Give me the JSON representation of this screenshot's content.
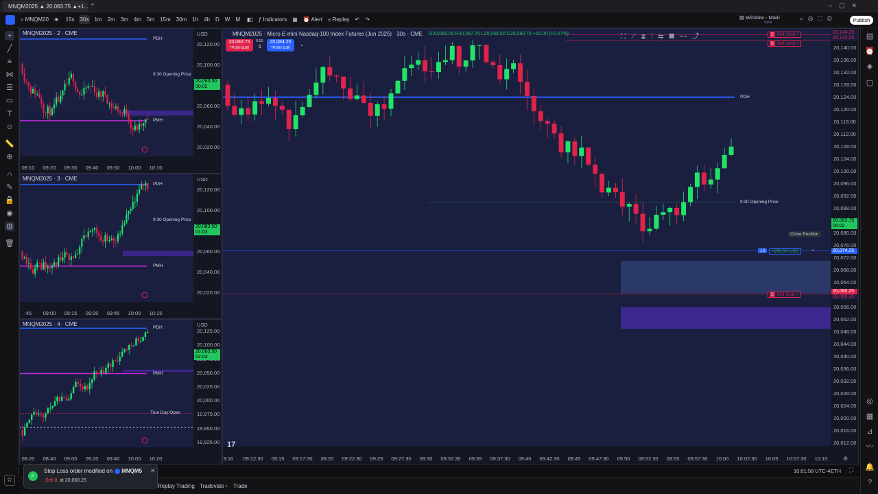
{
  "tab": {
    "title": "MNQM2025 ▲ 20,083.75 ▲+1..."
  },
  "toolbar": {
    "symbol": "MNQM20",
    "timeframes": [
      "15s",
      "30s",
      "1m",
      "2m",
      "3m",
      "4m",
      "5m",
      "15m",
      "30m",
      "1h",
      "4h",
      "D",
      "W",
      "M"
    ],
    "active_tf": "30s",
    "indicators": "Indicators",
    "alert": "Alert",
    "replay": "Replay",
    "layout": "Window - Main",
    "layout_sub": "Save",
    "publish": "Publish"
  },
  "main": {
    "title": "MNQM2025 · Micro E-mini Nasdaq-100 Index Futures (Jun 2025) · 30s · CME",
    "ohlc": "O20,069.00 H20,087.75 L20,068.50 C20,083.75 +15.00 (+0.07%)",
    "sell_price": "20,083.75",
    "sell_sub": "TP160·SL80",
    "spread": "0.50",
    "qty": "5",
    "buy_price": "20,084.25",
    "buy_sub": "TP160·SL80",
    "currency": "USD",
    "pdh": "PDH",
    "opening": "9:30 Opening Price",
    "close_position": "Close Position",
    "pos_qty": "13",
    "pos_pnl": "+250.50 USD",
    "sell_limit_1_qty": "5",
    "sell_limit_1": "Sell Limit",
    "sell_limit_2_qty": "8",
    "sell_limit_2": "Sell Limit",
    "sell_stop_qty": "5",
    "sell_stop": "Sell Stop",
    "last_price": "20,083.75",
    "last_time": "00:02",
    "pos_price": "20,074.25",
    "stop_price_1": "20,060.25",
    "stop_price_2": "20,060.25",
    "limit_price_1": "20,144.25",
    "limit_price_2": "20,142.25",
    "yticks": [
      "20,140.00",
      "20,136.00",
      "20,132.00",
      "20,128.00",
      "20,124.00",
      "20,120.00",
      "20,116.00",
      "20,112.00",
      "20,108.00",
      "20,104.00",
      "20,100.00",
      "20,096.00",
      "20,092.00",
      "20,088.00",
      "20,084.00",
      "20,080.00",
      "20,076.00",
      "20,072.00",
      "20,068.00",
      "20,064.00",
      "20,060.00",
      "20,056.00",
      "20,052.00",
      "20,048.00",
      "20,044.00",
      "20,040.00",
      "20,036.00",
      "20,032.00",
      "20,028.00",
      "20,024.00",
      "20,020.00",
      "20,016.00",
      "20,012.00"
    ],
    "xticks": [
      "9:10",
      "09:12:30",
      "09:15",
      "09:17:30",
      "09:20",
      "09:22:30",
      "09:25",
      "09:27:30",
      "09:30",
      "09:32:30",
      "09:35",
      "09:37:30",
      "09:40",
      "09:42:30",
      "09:45",
      "09:47:30",
      "09:50",
      "09:52:30",
      "09:55",
      "09:57:30",
      "10:00",
      "10:02:30",
      "10:05",
      "10:07:30",
      "10:10"
    ]
  },
  "p2": {
    "title": "MNQM2025 · 2 · CME",
    "currency": "USD",
    "pdh": "PDH",
    "opening": "9:30 Opening Price",
    "pmh": "PMH",
    "price": "20,083.50",
    "time": "00:02",
    "yticks": [
      "20,120.00",
      "20,100.00",
      "20,080.00",
      "20,060.00",
      "20,040.00",
      "20,020.00"
    ],
    "xticks": [
      "09:10",
      "09:20",
      "09:30",
      "09:40",
      "09:50",
      "10:00",
      "10:10"
    ]
  },
  "p3": {
    "title": "MNQM2025 · 3 · CME",
    "currency": "USD",
    "pdh": "PDH",
    "opening": "9:30 Opening Price",
    "pmh": "PMH",
    "price": "20,083.50",
    "time": "01:03",
    "yticks": [
      "20,120.00",
      "20,100.00",
      "20,080.00",
      "20,060.00",
      "20,040.00",
      "20,020.00"
    ],
    "xticks": [
      ":45",
      "09:00",
      "09:15",
      "09:30",
      "09:45",
      "10:00",
      "10:15"
    ]
  },
  "p4": {
    "title": "MNQM2025 · 4 · CME",
    "currency": "USD",
    "pdh": "PDH",
    "pmh": "PMH",
    "tdo": "True Day Open",
    "price": "20,083.50",
    "time": "02:03",
    "yticks": [
      "20,125.00",
      "20,100.00",
      "20,075.00",
      "20,050.00",
      "20,025.00",
      "20,000.00",
      "19,975.00",
      "19,950.00",
      "19,925.00"
    ],
    "xticks": [
      "08:20",
      "08:40",
      "09:00",
      "09:20",
      "09:40",
      "10:00",
      "10:20"
    ]
  },
  "bottom": {
    "time": "10:01:58 UTC-4",
    "session": "ETH",
    "tabs": [
      "Replay Trading",
      "Tradovate",
      "Trade"
    ]
  },
  "toast": {
    "title": "Stop Loss order modified on",
    "symbol": "MNQM5",
    "side": "Sell 8",
    "price": "at 20,060.25"
  },
  "colors": {
    "bg": "#1a1f40",
    "up": "#22e36a",
    "down": "#e0234b",
    "pdh": "#2962ff",
    "pmh": "#c32bd8",
    "zone": "#5b2fd0"
  }
}
